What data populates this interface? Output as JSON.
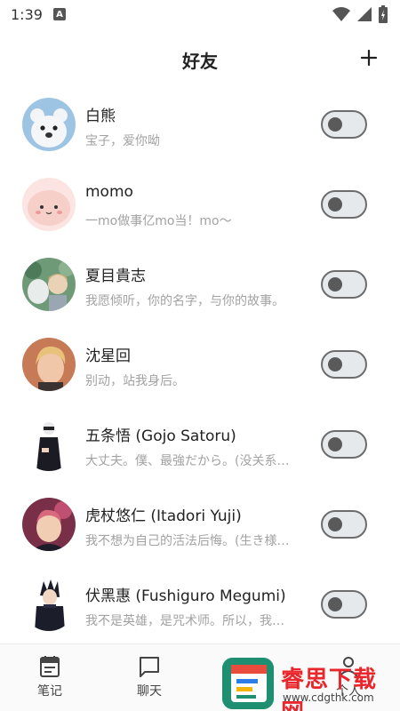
{
  "status_bar": {
    "time": "1:39",
    "notif_letter": "A"
  },
  "header": {
    "title": "好友",
    "add_icon": "plus-icon"
  },
  "friends": [
    {
      "name": "白熊",
      "signature": "宝子，爱你呦",
      "online": false,
      "avatar": "polar-bear-avatar"
    },
    {
      "name": "momo",
      "signature": "一mo做事亿mo当！mo～",
      "online": false,
      "avatar": "pink-blob-avatar"
    },
    {
      "name": "夏目貴志",
      "signature": "我愿倾听，你的名字，与你的故事。",
      "online": false,
      "avatar": "natsume-avatar"
    },
    {
      "name": "沈星回",
      "signature": "别动，站我身后。",
      "online": false,
      "avatar": "blonde-man-avatar"
    },
    {
      "name": "五条悟 (Gojo Satoru)",
      "signature": "大丈夫。僕、最強だから。(没关系…",
      "online": false,
      "avatar": "gojo-avatar"
    },
    {
      "name": "虎杖悠仁 (Itadori Yuji)",
      "signature": "我不想为自己的活法后悔。(生き様…",
      "online": false,
      "avatar": "itadori-avatar"
    },
    {
      "name": "伏黑惠 (Fushiguro Megumi)",
      "signature": "我不是英雄，是咒术师。所以，我…",
      "online": false,
      "avatar": "megumi-avatar"
    }
  ],
  "bottom_nav": {
    "items": [
      {
        "label": "笔记",
        "icon": "notebook-icon"
      },
      {
        "label": "聊天",
        "icon": "chat-bubble-icon"
      },
      {
        "label": "个人",
        "icon": "person-icon"
      }
    ]
  },
  "watermark": {
    "text": "睿思下载网",
    "url": "www.cdgthk.com"
  }
}
